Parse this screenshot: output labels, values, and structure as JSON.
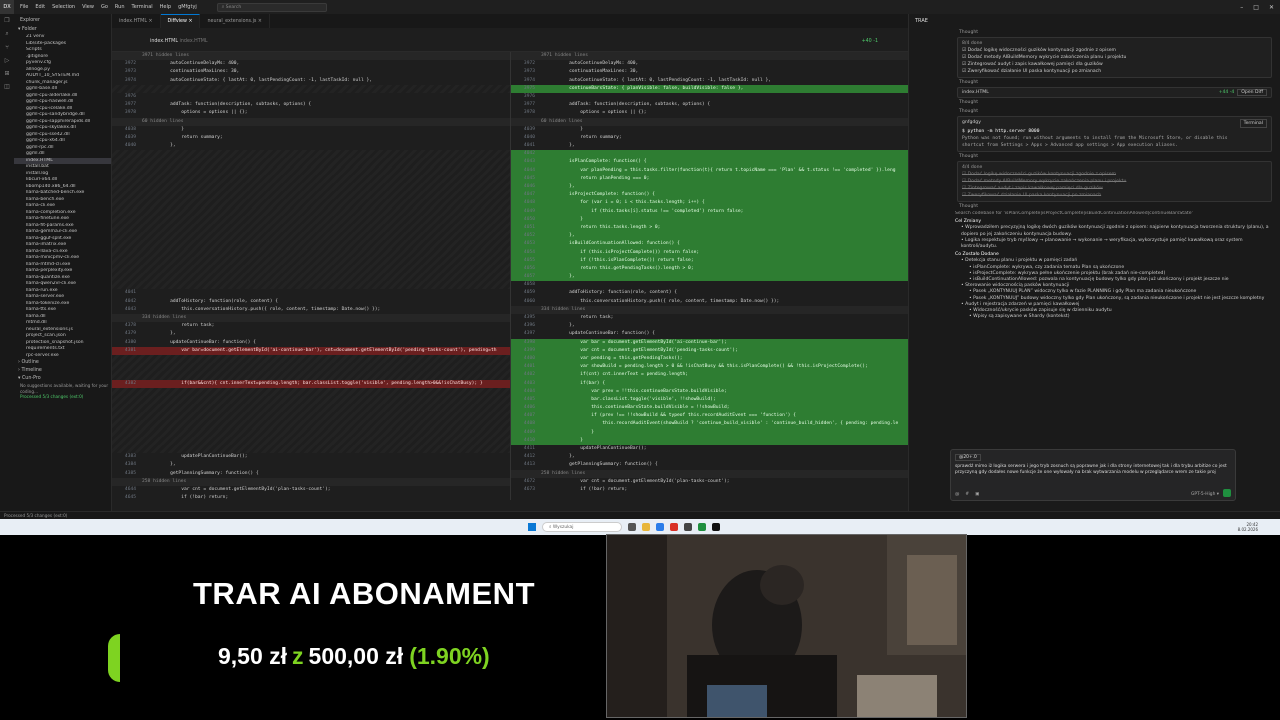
{
  "titlebar": {
    "logo": "DX",
    "menu": [
      "File",
      "Edit",
      "Selection",
      "View",
      "Go",
      "Run",
      "Terminal",
      "Help",
      "gMfgtyj"
    ],
    "search": "Search"
  },
  "explorer": {
    "title": "Explorer",
    "folder": "Folder",
    "files": [
      "21 venv",
      "Lib\\site-packages",
      "Scripts",
      ".gitignore",
      "pyvenv.cfg",
      "allnoge.py",
      "AUDYT_10_SYSTEM.md",
      "chunk_manager.js",
      "ggml-base.dll",
      "ggml-cpu-alderlake.dll",
      "ggml-cpu-haswell.dll",
      "ggml-cpu-icelake.dll",
      "ggml-cpu-sandybridge.dll",
      "ggml-cpu-sapphirerapids.dll",
      "ggml-cpu-skylakex.dll",
      "ggml-cpu-sse42.dll",
      "ggml-cpu-x64.dll",
      "ggml-rpc.dll",
      "ggml.dll",
      "index.HTML",
      "install.bat",
      "install.log",
      "libcurl-x64.dll",
      "libomp140.x86_64.dll",
      "llama-batched-bench.exe",
      "llama-bench.exe",
      "llama-cli.exe",
      "llama-completion.exe",
      "llama-finetune.exe",
      "llama-fit-params.exe",
      "llama-gemma3-cli.exe",
      "llama-gguf-split.exe",
      "llama-imatrix.exe",
      "llama-llava-cli.exe",
      "llama-minicpmv-cli.exe",
      "llama-mtmd-cli.exe",
      "llama-perplexity.exe",
      "llama-quantize.exe",
      "llama-qwen2vl-cli.exe",
      "llama-run.exe",
      "llama-server.exe",
      "llama-tokenize.exe",
      "llama-tts.exe",
      "llama.dll",
      "mtmd.dll",
      "neural_extensions.js",
      "project_scan.json",
      "protection_snapshot.json",
      "requirements.txt",
      "rpc-server.exe"
    ],
    "active": "index.HTML",
    "outline": "Outline",
    "timeline": "Timeline",
    "cunpro": "Cun-Pro",
    "cunpro_lines": [
      "No suggestions available, waiting for your",
      "coding..."
    ],
    "processed": "Processed 5/3 changes (ext:0)"
  },
  "tabs": [
    "index.HTML",
    "Diffview",
    "neural_extensions.js"
  ],
  "diff": {
    "file_label": "index.HTML",
    "file_sub": "index.HTML",
    "changes": "+40 -1"
  },
  "left_lines": [
    {
      "t": "hid",
      "c": "3971 hidden lines"
    },
    {
      "n": "3972",
      "c": "        autoContinueDelayMs: 400,"
    },
    {
      "n": "3973",
      "c": "        continuationMaxLines: 30,"
    },
    {
      "n": "3974",
      "c": "        autoContinueState: { lastAt: 0, lastPendingCount: -1, lastTaskId: null },"
    },
    {
      "t": "blank"
    },
    {
      "n": "3976",
      "c": ""
    },
    {
      "n": "3977",
      "c": "        addTask: function(description, subtasks, options) {"
    },
    {
      "n": "3978",
      "c": "            options = options || {};"
    },
    {
      "t": "hid",
      "c": "60 hidden lines"
    },
    {
      "n": "4038",
      "c": "            }"
    },
    {
      "n": "4039",
      "c": "            return summary;"
    },
    {
      "n": "4040",
      "c": "        },"
    },
    {
      "t": "blank"
    },
    {
      "t": "blank"
    },
    {
      "t": "blank"
    },
    {
      "t": "blank"
    },
    {
      "t": "blank"
    },
    {
      "t": "blank"
    },
    {
      "t": "blank"
    },
    {
      "t": "blank"
    },
    {
      "t": "blank"
    },
    {
      "t": "blank"
    },
    {
      "t": "blank"
    },
    {
      "t": "blank"
    },
    {
      "t": "blank"
    },
    {
      "t": "blank"
    },
    {
      "t": "blank"
    },
    {
      "t": "blank"
    },
    {
      "t": "blank"
    },
    {
      "n": "4041",
      "c": ""
    },
    {
      "n": "4042",
      "c": "        addToHistory: function(role, content) {"
    },
    {
      "n": "4043",
      "c": "            this.conversationHistory.push({ role, content, timestamp: Date.now() });"
    },
    {
      "t": "hid",
      "c": "334 hidden lines"
    },
    {
      "n": "4378",
      "c": "            return task;"
    },
    {
      "n": "4379",
      "c": "        },"
    },
    {
      "n": "4380",
      "c": "        updateContinueBar: function() {"
    },
    {
      "t": "del",
      "n": "4381",
      "c": "            var bar=document.getElementById('ai-continue-bar'), cnt=document.getElementById('pending-tasks-count'), pending=th"
    },
    {
      "t": "blank"
    },
    {
      "t": "blank"
    },
    {
      "t": "blank"
    },
    {
      "t": "del",
      "n": "4382",
      "c": "            if(bar&&cnt){ cnt.innerText=pending.length; bar.classList.toggle('visible', pending.length>0&&!isChatBusy); }"
    },
    {
      "t": "blank"
    },
    {
      "t": "blank"
    },
    {
      "t": "blank"
    },
    {
      "t": "blank"
    },
    {
      "t": "blank"
    },
    {
      "t": "blank"
    },
    {
      "t": "blank"
    },
    {
      "t": "blank"
    },
    {
      "n": "4383",
      "c": "            updatePlanContinueBar();"
    },
    {
      "n": "4384",
      "c": "        },"
    },
    {
      "n": "4385",
      "c": "        getPlanningSummary: function() {"
    },
    {
      "t": "hid",
      "c": "258 hidden lines"
    },
    {
      "n": "4644",
      "c": "            var cnt = document.getElementById('plan-tasks-count');"
    },
    {
      "n": "4645",
      "c": "            if (!bar) return;"
    }
  ],
  "right_lines": [
    {
      "t": "hid",
      "c": "3971 hidden lines"
    },
    {
      "n": "3972",
      "c": "        autoContinueDelayMs: 400,"
    },
    {
      "n": "3973",
      "c": "        continuationMaxLines: 30,"
    },
    {
      "n": "3974",
      "c": "        autoContinueState: { lastAt: 0, lastPendingCount: -1, lastTaskId: null },"
    },
    {
      "t": "add",
      "n": "3975",
      "c": "        continueBarsState: { planVisible: false, buildVisible: false },"
    },
    {
      "n": "3976",
      "c": ""
    },
    {
      "n": "3977",
      "c": "        addTask: function(description, subtasks, options) {"
    },
    {
      "n": "3978",
      "c": "            options = options || {};"
    },
    {
      "t": "hid",
      "c": "60 hidden lines"
    },
    {
      "n": "4039",
      "c": "            }"
    },
    {
      "n": "4040",
      "c": "            return summary;"
    },
    {
      "n": "4041",
      "c": "        },"
    },
    {
      "t": "add",
      "n": "4042",
      "c": ""
    },
    {
      "t": "add",
      "n": "4043",
      "c": "        isPlanComplete: function() {"
    },
    {
      "t": "add",
      "n": "4044",
      "c": "            var planPending = this.tasks.filter(function(t){ return t.topicName === 'Plan' && t.status !== 'completed' }).leng"
    },
    {
      "t": "add",
      "n": "4045",
      "c": "            return planPending === 0;"
    },
    {
      "t": "add",
      "n": "4046",
      "c": "        },"
    },
    {
      "t": "add",
      "n": "4047",
      "c": "        isProjectComplete: function() {"
    },
    {
      "t": "add",
      "n": "4048",
      "c": "            for (var i = 0; i < this.tasks.length; i++) {"
    },
    {
      "t": "add",
      "n": "4049",
      "c": "                if (this.tasks[i].status !== 'completed') return false;"
    },
    {
      "t": "add",
      "n": "4050",
      "c": "            }"
    },
    {
      "t": "add",
      "n": "4051",
      "c": "            return this.tasks.length > 0;"
    },
    {
      "t": "add",
      "n": "4052",
      "c": "        },"
    },
    {
      "t": "add",
      "n": "4053",
      "c": "        isBuildContinuationAllowed: function() {"
    },
    {
      "t": "add",
      "n": "4054",
      "c": "            if (this.isProjectComplete()) return false;"
    },
    {
      "t": "add",
      "n": "4055",
      "c": "            if (!this.isPlanComplete()) return false;"
    },
    {
      "t": "add",
      "n": "4056",
      "c": "            return this.getPendingTasks().length > 0;"
    },
    {
      "t": "add",
      "n": "4057",
      "c": "        },"
    },
    {
      "n": "4058",
      "c": ""
    },
    {
      "n": "4059",
      "c": "        addToHistory: function(role, content) {"
    },
    {
      "n": "4060",
      "c": "            this.conversationHistory.push({ role, content, timestamp: Date.now() });"
    },
    {
      "t": "hid",
      "c": "334 hidden lines"
    },
    {
      "n": "4395",
      "c": "            return task;"
    },
    {
      "n": "4396",
      "c": "        },"
    },
    {
      "n": "4397",
      "c": "        updateContinueBar: function() {"
    },
    {
      "t": "add",
      "n": "4398",
      "c": "            var bar = document.getElementById('ai-continue-bar');"
    },
    {
      "t": "add",
      "n": "4399",
      "c": "            var cnt = document.getElementById('pending-tasks-count');"
    },
    {
      "t": "add",
      "n": "4400",
      "c": "            var pending = this.getPendingTasks();"
    },
    {
      "t": "add",
      "n": "4401",
      "c": "            var showBuild = pending.length > 0 && !isChatBusy && this.isPlanComplete() && !this.isProjectComplete();"
    },
    {
      "t": "add",
      "n": "4402",
      "c": "            if(cnt) cnt.innerText = pending.length;"
    },
    {
      "t": "add",
      "n": "4403",
      "c": "            if(bar) {"
    },
    {
      "t": "add",
      "n": "4404",
      "c": "                var prev = !!this.continueBarsState.buildVisible;"
    },
    {
      "t": "add",
      "n": "4405",
      "c": "                bar.classList.toggle('visible', !!showBuild);"
    },
    {
      "t": "add",
      "n": "4406",
      "c": "                this.continueBarsState.buildVisible = !!showBuild;"
    },
    {
      "t": "add",
      "n": "4407",
      "c": "                if (prev !== !!showBuild && typeof this.recordAuditEvent === 'function') {"
    },
    {
      "t": "add",
      "n": "4408",
      "c": "                    this.recordAuditEvent(showBuild ? 'continue_build_visible' : 'continue_build_hidden', { pending: pending.le"
    },
    {
      "t": "add",
      "n": "4409",
      "c": "                }"
    },
    {
      "t": "add",
      "n": "4410",
      "c": "            }"
    },
    {
      "n": "4411",
      "c": "            updatePlanContinueBar();"
    },
    {
      "n": "4412",
      "c": "        },"
    },
    {
      "n": "4413",
      "c": "        getPlanningSummary: function() {"
    },
    {
      "t": "hid",
      "c": "258 hidden lines"
    },
    {
      "n": "4672",
      "c": "            var cnt = document.getElementById('plan-tasks-count');"
    },
    {
      "n": "4673",
      "c": "            if (!bar) return;"
    }
  ],
  "chat": {
    "title": "TRAE",
    "thought": "Thought",
    "todo_count": "8/4 done",
    "todos": [
      "Dodać logikę widoczności guzików kontynuacji zgodnie z opisem",
      "Dodać metody AIBuildMemory wykrycie zakończenia planu i projektu",
      "Zintegrować audyt i zapis kawałkowej pamięci dla guzików",
      "Zweryfikować działanie UI paska kontynuacji po zmianach"
    ],
    "file_card": "index.HTML",
    "file_card_changes": "+44 -4",
    "open_diff": "Open Diff",
    "terminal_label": "gnfgdgy",
    "terminal_tag": "Terminal",
    "cmd": "python -m http.server 8000",
    "cmd_out": [
      "Python was not found; run without arguments to install from the Microsoft Store, or disable this",
      "shortcut from Settings > Apps > Advanced app settings > App execution aliases."
    ],
    "todo_count2": "4/4 done",
    "search_line": "Search codebase for 'isPlanComplete|isProjectComplete|isBuildContinuationAllowed|continueBarsState'",
    "heading1": "Cel Zmiany",
    "b1": "Wprowadziłem precyzyjną logikę dwóch guzików kontynuacji zgodnie z opisem: najpierw kontynuacja tworzenia struktury (planu), a dopiero po jej zakończeniu kontynuacja budowy.",
    "b2": "Logika respektuje tryb myślowy → planowanie → wykonanie → weryfikacja, wykorzystuje pamięć kawałkową oraz system kontroli/audytu.",
    "heading2": "Co Zostało Dodane",
    "b3": "Detekcja stanu planu i projektu w pamięci zadań",
    "b3a": "isPlanComplete: wykrywa, czy zadania tematu Plan są ukończone",
    "b3b": "isProjectComplete: wykrywa pełne ukończenie projektu (brak zadań nie-completed)",
    "b3c": "isBuildContinuationAllowed: pozwala na kontynuację budowy tylko gdy plan już ukończony i projekt jeszcze nie",
    "b4": "Sterowanie widocznością pasków kontynuacji",
    "b4a": "Pasek „KONTYNUUJ PLAN” widoczny tylko w fazie PLANNING i gdy Plan ma zadania nieukończone",
    "b4b": "Pasek „KONTYNUUJ” budowy widoczny tylko gdy Plan ukończony, są zadania nieukończone i projekt nie jest jeszcze kompletny",
    "b5": "Audyt i rejestracja zdarzeń w pamięci kawałkowej",
    "b5a": "Widoczność/ukrycie pasków zapisuje się w dzienniku audytu",
    "b5b": "Wpisy są zapisywane w Shardy (kontekst)",
    "input_tag": "@20+.0",
    "input_text": "sprawdź mimo iż logika serwera i jego tryb zosnuch są poprawne jak i dla strony internetowej tak i dla trybu arbitize co jest przyczyną gdy dodałes nowe funkcje że one wyłowały na brak wytwarzania modelu w przeglądarce wrem ze takie proj",
    "model": "GPT-5-High"
  },
  "statusbar": {
    "left": "Processed 5/3 changes (ext:0)"
  },
  "taskbar": {
    "search": "Wyszukaj",
    "time": "20:42",
    "date": "8.02.2026"
  },
  "overlay": {
    "title": "TRAR AI ABONAMENT",
    "current": "9,50 zł",
    "z": "z",
    "goal": "500,00 zł",
    "percent": "(1.90%)",
    "progress_fraction": 0.019
  }
}
